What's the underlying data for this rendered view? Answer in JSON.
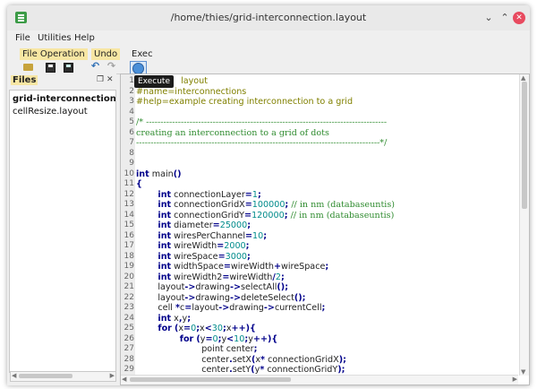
{
  "window": {
    "title": "/home/thies/grid-interconnection.layout"
  },
  "menubar": {
    "file": "File",
    "utilities": "Utilities",
    "help": "Help"
  },
  "toolbar": {
    "file_operation_label": "File Operation",
    "undo_label": "Undo",
    "exec_label": "Exec",
    "tooltip": "Execute"
  },
  "files_panel": {
    "title": "Files",
    "items": [
      "grid-interconnection.layo",
      "cellResize.layout"
    ]
  },
  "editor": {
    "lines": [
      {
        "n": "1",
        "segments": [
          {
            "c": "cm",
            "t": "#title=     layout"
          }
        ]
      },
      {
        "n": "2",
        "segments": [
          {
            "c": "cm",
            "t": "#name=interconnections"
          }
        ]
      },
      {
        "n": "3",
        "segments": [
          {
            "c": "cm",
            "t": "#help=example creating interconnection to a grid"
          }
        ]
      },
      {
        "n": "4",
        "segments": []
      },
      {
        "n": "5",
        "segments": [
          {
            "c": "cmg",
            "t": "/* -----------------------------------------------------------------------------------"
          }
        ]
      },
      {
        "n": "6",
        "segments": [
          {
            "c": "cmg",
            "t": "creating an interconnection to a grid of dots"
          }
        ]
      },
      {
        "n": "7",
        "segments": [
          {
            "c": "cmg",
            "t": "------------------------------------------------------------------------------------*/"
          }
        ]
      },
      {
        "n": "8",
        "segments": []
      },
      {
        "n": "9",
        "segments": []
      },
      {
        "n": "10",
        "segments": [
          {
            "c": "kw",
            "t": "int"
          },
          {
            "c": "",
            "t": " main"
          },
          {
            "c": "kw",
            "t": "()"
          }
        ]
      },
      {
        "n": "11",
        "segments": [
          {
            "c": "kw",
            "t": "{"
          }
        ]
      },
      {
        "n": "12",
        "segments": [
          {
            "c": "",
            "t": "        "
          },
          {
            "c": "kw",
            "t": "int"
          },
          {
            "c": "",
            "t": " connectionLayer"
          },
          {
            "c": "kw",
            "t": "="
          },
          {
            "c": "num",
            "t": "1"
          },
          {
            "c": "kw",
            "t": ";"
          }
        ]
      },
      {
        "n": "13",
        "segments": [
          {
            "c": "",
            "t": "        "
          },
          {
            "c": "kw",
            "t": "int"
          },
          {
            "c": "",
            "t": " connectionGridX"
          },
          {
            "c": "kw",
            "t": "="
          },
          {
            "c": "num",
            "t": "100000"
          },
          {
            "c": "kw",
            "t": ";"
          },
          {
            "c": "cmg",
            "t": " // in nm (databaseuntis)"
          }
        ]
      },
      {
        "n": "14",
        "segments": [
          {
            "c": "",
            "t": "        "
          },
          {
            "c": "kw",
            "t": "int"
          },
          {
            "c": "",
            "t": " connectionGridY"
          },
          {
            "c": "kw",
            "t": "="
          },
          {
            "c": "num",
            "t": "120000"
          },
          {
            "c": "kw",
            "t": ";"
          },
          {
            "c": "cmg",
            "t": " // in nm (databaseuntis)"
          }
        ]
      },
      {
        "n": "15",
        "segments": [
          {
            "c": "",
            "t": "        "
          },
          {
            "c": "kw",
            "t": "int"
          },
          {
            "c": "",
            "t": " diameter"
          },
          {
            "c": "kw",
            "t": "="
          },
          {
            "c": "num",
            "t": "25000"
          },
          {
            "c": "kw",
            "t": ";"
          }
        ]
      },
      {
        "n": "16",
        "segments": [
          {
            "c": "",
            "t": "        "
          },
          {
            "c": "kw",
            "t": "int"
          },
          {
            "c": "",
            "t": " wiresPerChannel"
          },
          {
            "c": "kw",
            "t": "="
          },
          {
            "c": "num",
            "t": "10"
          },
          {
            "c": "kw",
            "t": ";"
          }
        ]
      },
      {
        "n": "17",
        "segments": [
          {
            "c": "",
            "t": "        "
          },
          {
            "c": "kw",
            "t": "int"
          },
          {
            "c": "",
            "t": " wireWidth"
          },
          {
            "c": "kw",
            "t": "="
          },
          {
            "c": "num",
            "t": "2000"
          },
          {
            "c": "kw",
            "t": ";"
          }
        ]
      },
      {
        "n": "18",
        "segments": [
          {
            "c": "",
            "t": "        "
          },
          {
            "c": "kw",
            "t": "int"
          },
          {
            "c": "",
            "t": " wireSpace"
          },
          {
            "c": "kw",
            "t": "="
          },
          {
            "c": "num",
            "t": "3000"
          },
          {
            "c": "kw",
            "t": ";"
          }
        ]
      },
      {
        "n": "19",
        "segments": [
          {
            "c": "",
            "t": "        "
          },
          {
            "c": "kw",
            "t": "int"
          },
          {
            "c": "",
            "t": " widthSpace"
          },
          {
            "c": "kw",
            "t": "="
          },
          {
            "c": "",
            "t": "wireWidth"
          },
          {
            "c": "kw",
            "t": "+"
          },
          {
            "c": "",
            "t": "wireSpace"
          },
          {
            "c": "kw",
            "t": ";"
          }
        ]
      },
      {
        "n": "20",
        "segments": [
          {
            "c": "",
            "t": "        "
          },
          {
            "c": "kw",
            "t": "int"
          },
          {
            "c": "",
            "t": " wireWidth2"
          },
          {
            "c": "kw",
            "t": "="
          },
          {
            "c": "",
            "t": "wireWidth"
          },
          {
            "c": "kw",
            "t": "/"
          },
          {
            "c": "num",
            "t": "2"
          },
          {
            "c": "kw",
            "t": ";"
          }
        ]
      },
      {
        "n": "21",
        "segments": [
          {
            "c": "",
            "t": "        layout"
          },
          {
            "c": "kw",
            "t": "->"
          },
          {
            "c": "",
            "t": "drawing"
          },
          {
            "c": "kw",
            "t": "->"
          },
          {
            "c": "",
            "t": "selectAll"
          },
          {
            "c": "kw",
            "t": "();"
          }
        ]
      },
      {
        "n": "22",
        "segments": [
          {
            "c": "",
            "t": "        layout"
          },
          {
            "c": "kw",
            "t": "->"
          },
          {
            "c": "",
            "t": "drawing"
          },
          {
            "c": "kw",
            "t": "->"
          },
          {
            "c": "",
            "t": "deleteSelect"
          },
          {
            "c": "kw",
            "t": "();"
          }
        ]
      },
      {
        "n": "23",
        "segments": [
          {
            "c": "",
            "t": "        cell "
          },
          {
            "c": "kw",
            "t": "*"
          },
          {
            "c": "",
            "t": "c"
          },
          {
            "c": "kw",
            "t": "="
          },
          {
            "c": "",
            "t": "layout"
          },
          {
            "c": "kw",
            "t": "->"
          },
          {
            "c": "",
            "t": "drawing"
          },
          {
            "c": "kw",
            "t": "->"
          },
          {
            "c": "",
            "t": "currentCell"
          },
          {
            "c": "kw",
            "t": ";"
          }
        ]
      },
      {
        "n": "24",
        "segments": [
          {
            "c": "",
            "t": "        "
          },
          {
            "c": "kw",
            "t": "int"
          },
          {
            "c": "",
            "t": " x"
          },
          {
            "c": "kw",
            "t": ","
          },
          {
            "c": "",
            "t": "y"
          },
          {
            "c": "kw",
            "t": ";"
          }
        ]
      },
      {
        "n": "25",
        "segments": [
          {
            "c": "",
            "t": "        "
          },
          {
            "c": "kw",
            "t": "for"
          },
          {
            "c": "",
            "t": " "
          },
          {
            "c": "kw",
            "t": "("
          },
          {
            "c": "",
            "t": "x"
          },
          {
            "c": "kw",
            "t": "="
          },
          {
            "c": "num",
            "t": "0"
          },
          {
            "c": "kw",
            "t": ";"
          },
          {
            "c": "",
            "t": "x"
          },
          {
            "c": "kw",
            "t": "<"
          },
          {
            "c": "num",
            "t": "30"
          },
          {
            "c": "kw",
            "t": ";"
          },
          {
            "c": "",
            "t": "x"
          },
          {
            "c": "kw",
            "t": "++){"
          }
        ]
      },
      {
        "n": "26",
        "segments": [
          {
            "c": "",
            "t": "                "
          },
          {
            "c": "kw",
            "t": "for"
          },
          {
            "c": "",
            "t": " "
          },
          {
            "c": "kw",
            "t": "("
          },
          {
            "c": "",
            "t": "y"
          },
          {
            "c": "kw",
            "t": "="
          },
          {
            "c": "num",
            "t": "0"
          },
          {
            "c": "kw",
            "t": ";"
          },
          {
            "c": "",
            "t": "y"
          },
          {
            "c": "kw",
            "t": "<"
          },
          {
            "c": "num",
            "t": "10"
          },
          {
            "c": "kw",
            "t": ";"
          },
          {
            "c": "",
            "t": "y"
          },
          {
            "c": "kw",
            "t": "++){"
          }
        ]
      },
      {
        "n": "27",
        "segments": [
          {
            "c": "",
            "t": "                        point center"
          },
          {
            "c": "kw",
            "t": ";"
          }
        ]
      },
      {
        "n": "28",
        "segments": [
          {
            "c": "",
            "t": "                        center"
          },
          {
            "c": "kw",
            "t": "."
          },
          {
            "c": "",
            "t": "setX"
          },
          {
            "c": "kw",
            "t": "("
          },
          {
            "c": "",
            "t": "x"
          },
          {
            "c": "kw",
            "t": "*"
          },
          {
            "c": "",
            "t": " connectionGridX"
          },
          {
            "c": "kw",
            "t": ");"
          }
        ]
      },
      {
        "n": "29",
        "segments": [
          {
            "c": "",
            "t": "                        center"
          },
          {
            "c": "kw",
            "t": "."
          },
          {
            "c": "",
            "t": "setY"
          },
          {
            "c": "kw",
            "t": "("
          },
          {
            "c": "",
            "t": "y"
          },
          {
            "c": "kw",
            "t": "*"
          },
          {
            "c": "",
            "t": " connectionGridY"
          },
          {
            "c": "kw",
            "t": ");"
          }
        ]
      }
    ]
  }
}
